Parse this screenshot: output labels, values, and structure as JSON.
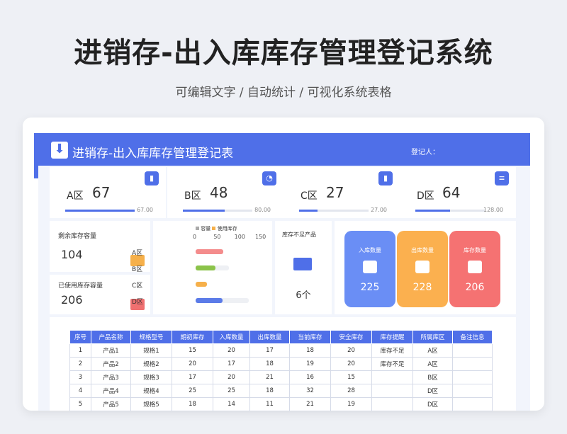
{
  "page_title": "进销存-出入库库存管理登记系统",
  "page_subtitle": "可编辑文字 / 自动统计 / 可视化系统表格",
  "sheet": {
    "title": "进销存-出入库库存管理登记表",
    "registrant_label": "登记人："
  },
  "kpis": [
    {
      "label": "A区",
      "value": "67",
      "max": "67.00",
      "fill": 1.0
    },
    {
      "label": "B区",
      "value": "48",
      "max": "80.00",
      "fill": 0.6
    },
    {
      "label": "C区",
      "value": "27",
      "max": "27.00",
      "fill": 0.27
    },
    {
      "label": "D区",
      "value": "64",
      "max": "128.00",
      "fill": 0.5
    }
  ],
  "remaining": {
    "label": "剩余库存容量",
    "value": "104"
  },
  "used": {
    "label": "已使用库存容量",
    "value": "206"
  },
  "chart_data": {
    "type": "bar",
    "legend": [
      "容量",
      "使用库存"
    ],
    "categories": [
      "A区",
      "B区",
      "C区",
      "D区"
    ],
    "series": [
      {
        "name": "容量",
        "values": [
          67,
          80,
          27,
          128
        ]
      },
      {
        "name": "使用库存",
        "values": [
          67,
          48,
          27,
          64
        ]
      }
    ],
    "xticks": [
      "0",
      "50",
      "100",
      "150"
    ],
    "xlim": [
      0,
      150
    ]
  },
  "shortage": {
    "label": "库存不足产品",
    "value": "6个"
  },
  "stats": [
    {
      "label": "入库数量",
      "value": "225",
      "color": "#6a8ef5"
    },
    {
      "label": "出库数量",
      "value": "228",
      "color": "#fbb04f"
    },
    {
      "label": "库存数量",
      "value": "206",
      "color": "#f57272"
    }
  ],
  "table": {
    "headers": [
      "序号",
      "产品名称",
      "规格型号",
      "期初库存",
      "入库数量",
      "出库数量",
      "当前库存",
      "安全库存",
      "库存提醒",
      "所属库区",
      "备注信息"
    ],
    "rows": [
      [
        "1",
        "产品1",
        "规格1",
        "15",
        "20",
        "17",
        "18",
        "20",
        "库存不足",
        "A区",
        ""
      ],
      [
        "2",
        "产品2",
        "规格2",
        "20",
        "17",
        "18",
        "19",
        "20",
        "库存不足",
        "A区",
        ""
      ],
      [
        "3",
        "产品3",
        "规格3",
        "17",
        "20",
        "21",
        "16",
        "15",
        "",
        "B区",
        ""
      ],
      [
        "4",
        "产品4",
        "规格4",
        "25",
        "25",
        "18",
        "32",
        "28",
        "",
        "D区",
        ""
      ],
      [
        "5",
        "产品5",
        "规格5",
        "18",
        "14",
        "11",
        "21",
        "19",
        "",
        "D区",
        ""
      ]
    ]
  }
}
